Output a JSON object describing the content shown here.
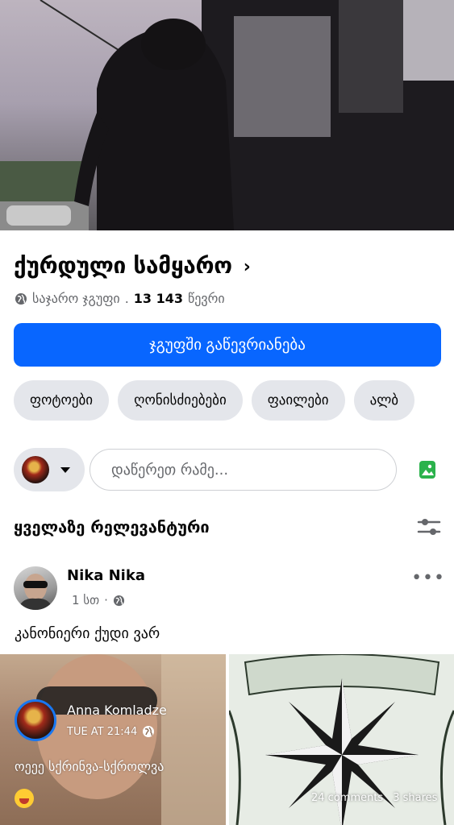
{
  "group": {
    "name": "ქურდული სამყარო",
    "privacy": "საჯარო ჯგუფი",
    "separator": ".",
    "members_count": "13 143",
    "members_label": "წევრი",
    "join_label": "ჯგუფში გაწევრიანება"
  },
  "tabs": [
    "ფოტოები",
    "ღონისძიებები",
    "ფაილები",
    "ალბ"
  ],
  "composer": {
    "placeholder": "დაწერეთ რამე..."
  },
  "sort": {
    "label": "ყველაზე რელევანტური"
  },
  "post": {
    "author": "Nika Nika",
    "time": "1 სთ",
    "dot": "·",
    "text": "კანონიერი ქუდი ვარ",
    "shared_post": {
      "author": "Anna Komladze",
      "time": "TUE AT 21:44",
      "text": "ოეეე სქრინვა-სქროლვა",
      "comments": "24 comments",
      "shares": "3 shares"
    }
  },
  "colors": {
    "accent": "#0866ff",
    "chip_bg": "#e4e6eb",
    "secondary_text": "#65676b"
  }
}
